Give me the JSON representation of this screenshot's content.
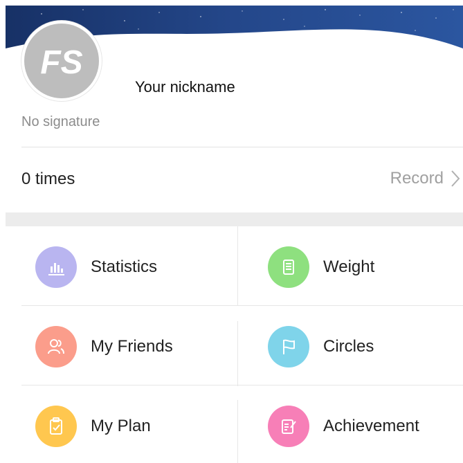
{
  "profile": {
    "avatar_text": "FS",
    "nickname": "Your nickname",
    "signature": "No signature"
  },
  "record": {
    "times": "0 times",
    "link_label": "Record"
  },
  "menu": [
    {
      "label": "Statistics",
      "icon": "bar-chart-icon",
      "color": "#b9b5f0"
    },
    {
      "label": "Weight",
      "icon": "document-icon",
      "color": "#8ee07f"
    },
    {
      "label": "My Friends",
      "icon": "friends-icon",
      "color": "#fb9d8b"
    },
    {
      "label": "Circles",
      "icon": "flag-icon",
      "color": "#7fd4ea"
    },
    {
      "label": "My Plan",
      "icon": "clipboard-check-icon",
      "color": "#ffc74f"
    },
    {
      "label": "Achievement",
      "icon": "note-edit-icon",
      "color": "#f77fb7"
    }
  ],
  "colors": {
    "header_dark": "#1d3a74",
    "header_light": "#2f5aa2"
  }
}
